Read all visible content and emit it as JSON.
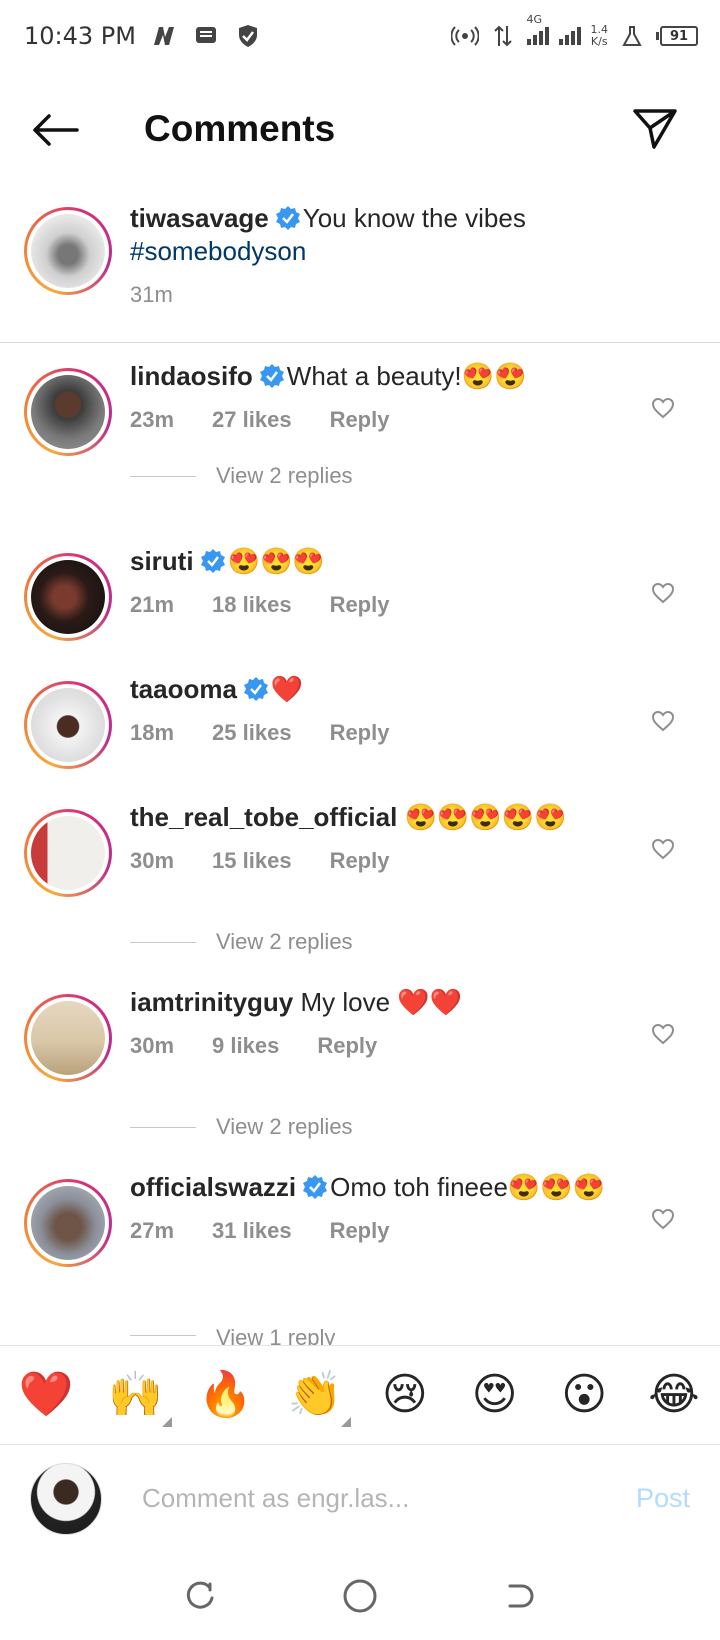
{
  "status_bar": {
    "time": "10:43 PM",
    "network": "4G",
    "speed_value": "1.4",
    "speed_unit": "K/s",
    "battery": "91"
  },
  "header": {
    "title": "Comments"
  },
  "caption": {
    "username": "tiwasavage",
    "text": "You know the vibes",
    "hashtag": "#somebodyson",
    "time": "31m",
    "colors": {
      "avatar_bg": "#d9d9d9"
    }
  },
  "comments": [
    {
      "username": "lindaosifo",
      "verified": true,
      "text": "What a beauty!😍😍",
      "time": "23m",
      "likes": "27 likes",
      "reply": "Reply",
      "view_replies": "View 2 replies",
      "avatar_color": "#6b4b3a"
    },
    {
      "username": "siruti",
      "verified": true,
      "text": "😍😍😍",
      "time": "21m",
      "likes": "18 likes",
      "reply": "Reply",
      "view_replies": "",
      "avatar_color": "#3a2320"
    },
    {
      "username": "taaooma",
      "verified": true,
      "text": "❤️",
      "time": "18m",
      "likes": "25 likes",
      "reply": "Reply",
      "view_replies": "",
      "avatar_color": "#e9e4df"
    },
    {
      "username": "the_real_tobe_official",
      "verified": false,
      "text": "😍😍😍😍😍",
      "time": "30m",
      "likes": "15 likes",
      "reply": "Reply",
      "view_replies": "View 2 replies",
      "avatar_color": "#c73b3b"
    },
    {
      "username": "iamtrinityguy",
      "verified": false,
      "text": "My love ❤️❤️",
      "time": "30m",
      "likes": "9 likes",
      "reply": "Reply",
      "view_replies": "View 2 replies",
      "avatar_color": "#d9c7a8"
    },
    {
      "username": "officialswazzi",
      "verified": true,
      "text": "Omo toh fineee😍😍😍",
      "time": "27m",
      "likes": "31 likes",
      "reply": "Reply",
      "view_replies": "View 1 reply",
      "avatar_color": "#8a8f99"
    }
  ],
  "emoji_bar": [
    "❤️",
    "🙌",
    "🔥",
    "👏",
    "😢",
    "😍",
    "😮",
    "😂"
  ],
  "input": {
    "placeholder": "Comment as engr.las...",
    "post_label": "Post"
  },
  "colors": {
    "verified_blue": "#3897f0",
    "hashtag": "#00376b",
    "meta_grey": "#8e8e8e",
    "post_disabled": "#b3dbff"
  }
}
